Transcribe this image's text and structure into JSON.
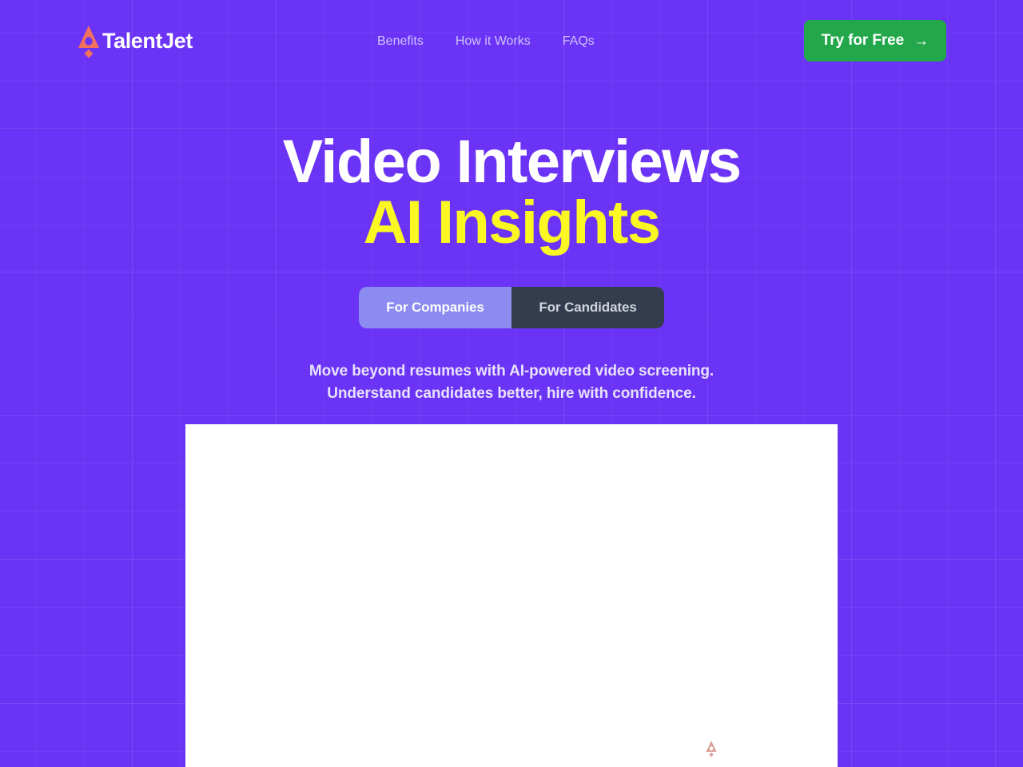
{
  "brand": {
    "name": "TalentJet",
    "logo_icon": "talentjet-triangle-diamond-icon",
    "logo_color": "#f4705f"
  },
  "header": {
    "nav_items": [
      {
        "label": "Benefits"
      },
      {
        "label": "How it Works"
      },
      {
        "label": "FAQs"
      }
    ],
    "cta": {
      "label": "Try for Free",
      "arrow_icon": "→",
      "background_color": "#22a84a",
      "text_color": "#ffffff"
    }
  },
  "hero": {
    "title_line1": "Video Interviews",
    "title_line2": "AI Insights",
    "title_line1_color": "#ffffff",
    "title_line2_color": "#faf723",
    "audience_toggle": {
      "options": [
        {
          "label": "For Companies",
          "selected": true
        },
        {
          "label": "For Candidates",
          "selected": false
        }
      ],
      "active_background": "#8b8bf0",
      "inactive_background": "#343d4d"
    },
    "subtitle_line1": "Move beyond resumes with AI-powered video screening.",
    "subtitle_line2": "Understand candidates better, hire with confidence."
  },
  "preview": {
    "placeholder_icon": "talentjet-loading-mark-icon",
    "background_color": "#ffffff"
  },
  "theme": {
    "page_background": "#6b33f5",
    "accent_yellow": "#faf723",
    "accent_coral": "#f4705f"
  }
}
